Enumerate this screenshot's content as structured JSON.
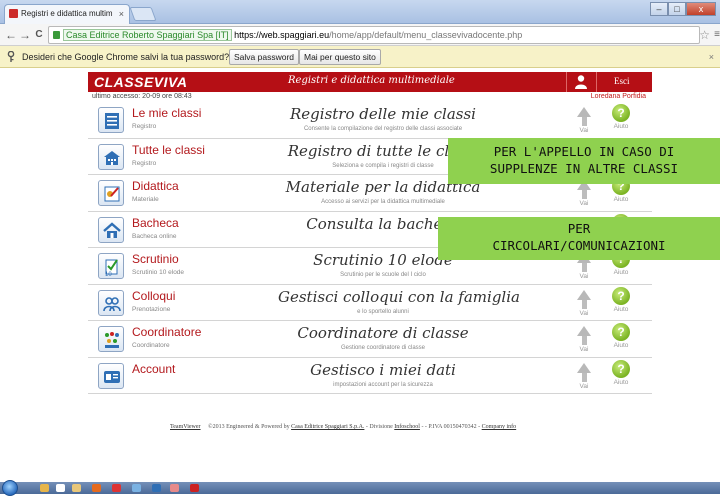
{
  "browser": {
    "tab_title": "Registri e didattica multim",
    "tab_close": "×",
    "back": "←",
    "forward": "→",
    "reload": "C",
    "secure_label": "Casa Editrice Roberto Spaggiari Spa [IT]",
    "url_domain": "https://web.spaggiari.eu",
    "url_path": "/home/app/default/menu_classevivadocente.php",
    "star": "☆",
    "menu": "≡",
    "window_min": "–",
    "window_max": "□",
    "window_close": "x"
  },
  "infobar": {
    "message": "Desideri che Google Chrome salvi la tua password?",
    "save_button": "Salva password",
    "never_button": "Mai per questo sito",
    "close": "×"
  },
  "header": {
    "logo": "CLASSEVIVA",
    "title": "Registri e didattica multimediale",
    "logout": "Esci"
  },
  "subheader": {
    "last_access": "ultimo accesso: 20-09 ore 08:43",
    "user": "Loredana Porfidia"
  },
  "menu": [
    {
      "label": "Le mie classi",
      "sublabel": "Registro",
      "title": "Registro delle mie classi",
      "subtitle": "Consente la compilazione del registro delle classi associate",
      "icon": "register-icon"
    },
    {
      "label": "Tutte le classi",
      "sublabel": "Registro",
      "title": "Registro di tutte le classi",
      "subtitle": "Seleziona e compila i registri di classe",
      "icon": "school-icon"
    },
    {
      "label": "Didattica",
      "sublabel": "Materiale",
      "title": "Materiale per la didattica",
      "subtitle": "Accesso ai servizi per la didattica multimediale",
      "icon": "paint-icon"
    },
    {
      "label": "Bacheca",
      "sublabel": "Bacheca online",
      "title": "Consulta la bacheca",
      "subtitle": "",
      "icon": "home-icon"
    },
    {
      "label": "Scrutinio",
      "sublabel": "Scrutinio 10 elode",
      "title": "Scrutinio 10 elode",
      "subtitle": "Scrutinio per le scuole del I ciclo",
      "icon": "checklist-icon"
    },
    {
      "label": "Colloqui",
      "sublabel": "Prenotazione",
      "title": "Gestisci colloqui con la famiglia",
      "subtitle": "e lo sportello alunni",
      "icon": "people-icon"
    },
    {
      "label": "Coordinatore",
      "sublabel": "Coordinatore",
      "title": "Coordinatore di classe",
      "subtitle": "Gestione coordinatore di classe",
      "icon": "group-icon"
    },
    {
      "label": "Account",
      "sublabel": "",
      "title": "Gestisco i miei dati",
      "subtitle": "impostazioni account per la sicurezza",
      "icon": "account-icon"
    }
  ],
  "actions": {
    "go": "Vai",
    "help": "Aiuto",
    "help_glyph": "?"
  },
  "footer": {
    "teamviewer": "TeamViewer",
    "copyright": "©2013 Engineered & Powered by",
    "company": "Casa Editrice Spaggiari S.p.A.",
    "division": "- Divisione",
    "infoschool": "Infoschool",
    "piva": "- - P.IVA 00150470342 -",
    "company_info": "Company info"
  },
  "notes": {
    "appello": [
      "PER L'APPELLO IN CASO DI",
      "SUPPLENZE IN ALTRE CLASSI"
    ],
    "circolari": [
      "PER",
      "CIRCOLARI/COMUNICAZIONI"
    ]
  },
  "colors": {
    "brand_red": "#b50f15",
    "note_green": "#8fd14f",
    "help_green": "#7bb323"
  }
}
